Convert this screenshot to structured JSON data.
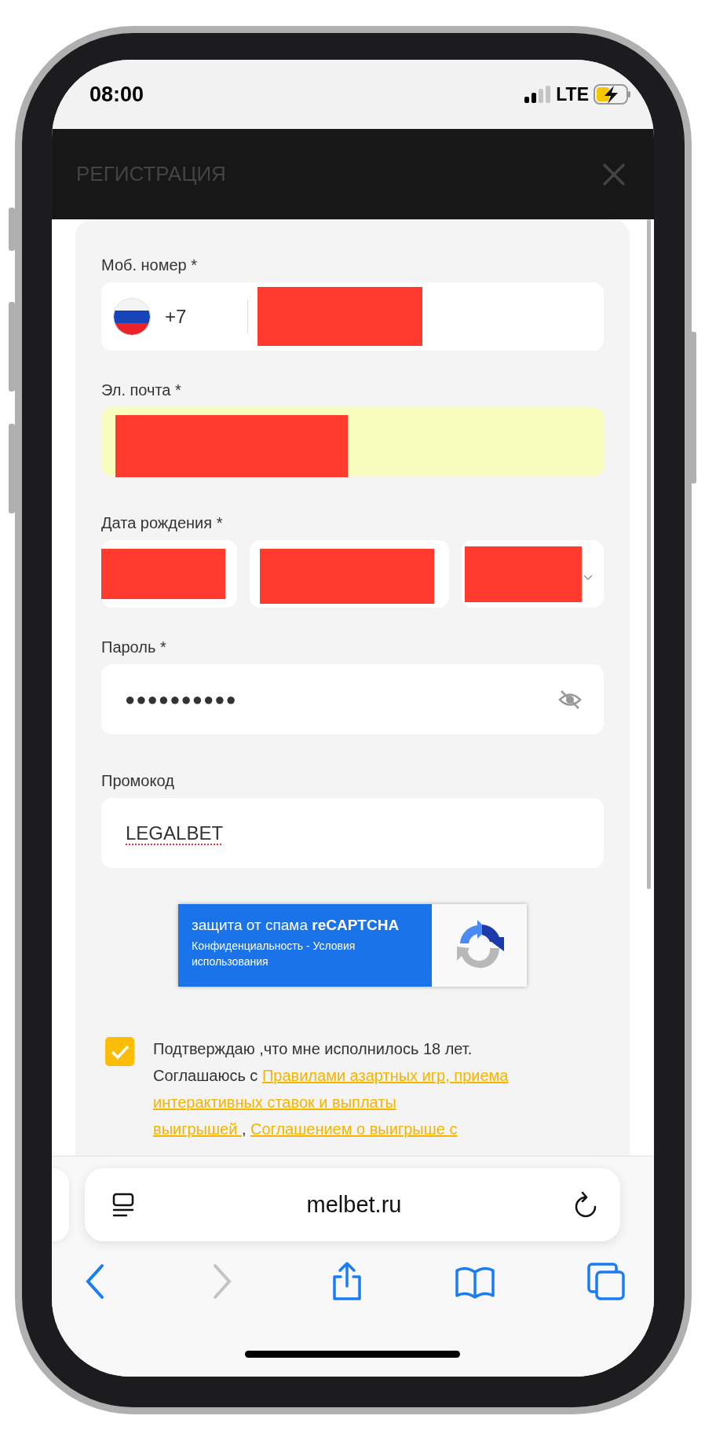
{
  "status_bar": {
    "time": "08:00",
    "network": "LTE"
  },
  "header": {
    "title": "РЕГИСТРАЦИЯ"
  },
  "form": {
    "phone": {
      "label": "Моб. номер *",
      "country_code": "+7"
    },
    "email": {
      "label": "Эл. почта *",
      "autofilled": true
    },
    "birth_date": {
      "label": "Дата рождения *"
    },
    "password": {
      "label": "Пароль *",
      "value": "●●●●●●●●●●"
    },
    "promo_code": {
      "label": "Промокод",
      "value": "LEGALBET",
      "spelling_error": true
    }
  },
  "captcha": {
    "title": "защита от спама **reCAPTCHA**",
    "links": "Конфиденциальность - Условия использования"
  },
  "consent": {
    "checked": true,
    "lines": [
      [
        {
          "text": "Подтверждаю ,что мне исполнилось 18 лет.",
          "link": false
        }
      ],
      [
        {
          "text": "Соглашаюсь с ",
          "link": false
        },
        {
          "text": "Правилами азартных игр, приема",
          "link": true
        }
      ],
      [
        {
          "text": "интерактивных ставок и выплаты",
          "link": true
        }
      ],
      [
        {
          "text": "выигрышей ",
          "link": true
        },
        {
          "text": " , ",
          "link": false
        },
        {
          "text": "Соглашением о выигрыше с",
          "link": true
        }
      ]
    ]
  },
  "browser": {
    "url": "melbet.ru",
    "buttons": [
      {
        "kind": "back",
        "disabled": false
      },
      {
        "kind": "forward",
        "disabled": true
      },
      {
        "kind": "share",
        "disabled": false
      },
      {
        "kind": "bookmarks",
        "disabled": false
      },
      {
        "kind": "tabs",
        "disabled": false
      }
    ]
  }
}
